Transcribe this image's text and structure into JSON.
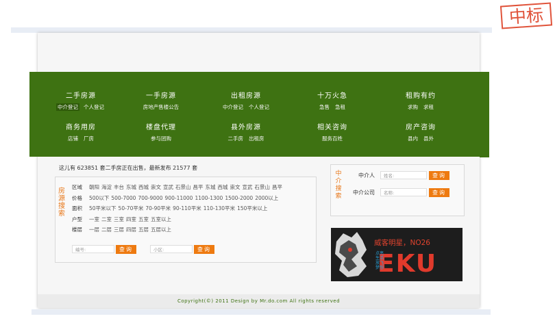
{
  "stamp": "中标",
  "nav": [
    {
      "title": "二手房源",
      "subs": [
        "中介登记",
        "个人登记"
      ],
      "active": 0
    },
    {
      "title": "一手房源",
      "subs": [
        "房地产售楼公告"
      ],
      "active": -1
    },
    {
      "title": "出租房源",
      "subs": [
        "中介登记",
        "个人登记"
      ],
      "active": -1
    },
    {
      "title": "十万火急",
      "subs": [
        "急售",
        "急租"
      ],
      "active": -1
    },
    {
      "title": "租购有约",
      "subs": [
        "求购",
        "求租"
      ],
      "active": -1
    },
    {
      "title": "商务用房",
      "subs": [
        "店铺",
        "厂房"
      ],
      "active": -1
    },
    {
      "title": "楼盘代理",
      "subs": [
        "参与团购"
      ],
      "active": -1
    },
    {
      "title": "县外房源",
      "subs": [
        "二手房",
        "出租房"
      ],
      "active": -1
    },
    {
      "title": "相关咨询",
      "subs": [
        "服务百姓"
      ],
      "active": -1
    },
    {
      "title": "房产咨询",
      "subs": [
        "县内",
        "县外"
      ],
      "active": -1
    }
  ],
  "stats": "这儿有 623851 套二手房正在出售，最新发布 21577 套",
  "search": {
    "label": "房源搜索",
    "rows": [
      {
        "key": "区域",
        "values": [
          "朝阳",
          "海淀",
          "丰台",
          "东城",
          "西城",
          "崇文",
          "宣武",
          "石景山",
          "昌平",
          "东城",
          "西城",
          "崇文",
          "宣武",
          "石景山",
          "昌平"
        ]
      },
      {
        "key": "价格",
        "values": [
          "500以下",
          "500-7000",
          "700-9000",
          "900-11000",
          "1100-1300",
          "1500-2000",
          "2000以上"
        ]
      },
      {
        "key": "面积",
        "values": [
          "50平米以下",
          "50-70平米",
          "70-90平米",
          "90-110平米",
          "110-130平米",
          "150平米以上"
        ]
      },
      {
        "key": "户型",
        "values": [
          "一室",
          "二室",
          "三室",
          "四室",
          "五室",
          "五室以上"
        ]
      },
      {
        "key": "楼层",
        "values": [
          "一层",
          "二层",
          "三层",
          "四层",
          "五层",
          "五层以上"
        ]
      }
    ],
    "number_placeholder": "编号:",
    "area_placeholder": "小区:",
    "button": "查询"
  },
  "agent": {
    "label": "中介搜索",
    "person_label": "中介人",
    "person_placeholder": "姓名:",
    "company_label": "中介公司",
    "company_placeholder": "名称:",
    "button": "查询"
  },
  "ad": {
    "title": "威客明星，NO26",
    "subtitle": "点亮生活 放飞梦想",
    "big": "EKU"
  },
  "footer": "Copyright(©) 2011  Design by Mr.do.com  All rights reserved",
  "colors": {
    "nav": "#3e7212",
    "accent": "#ee7a10",
    "stamp": "#e0533a"
  }
}
